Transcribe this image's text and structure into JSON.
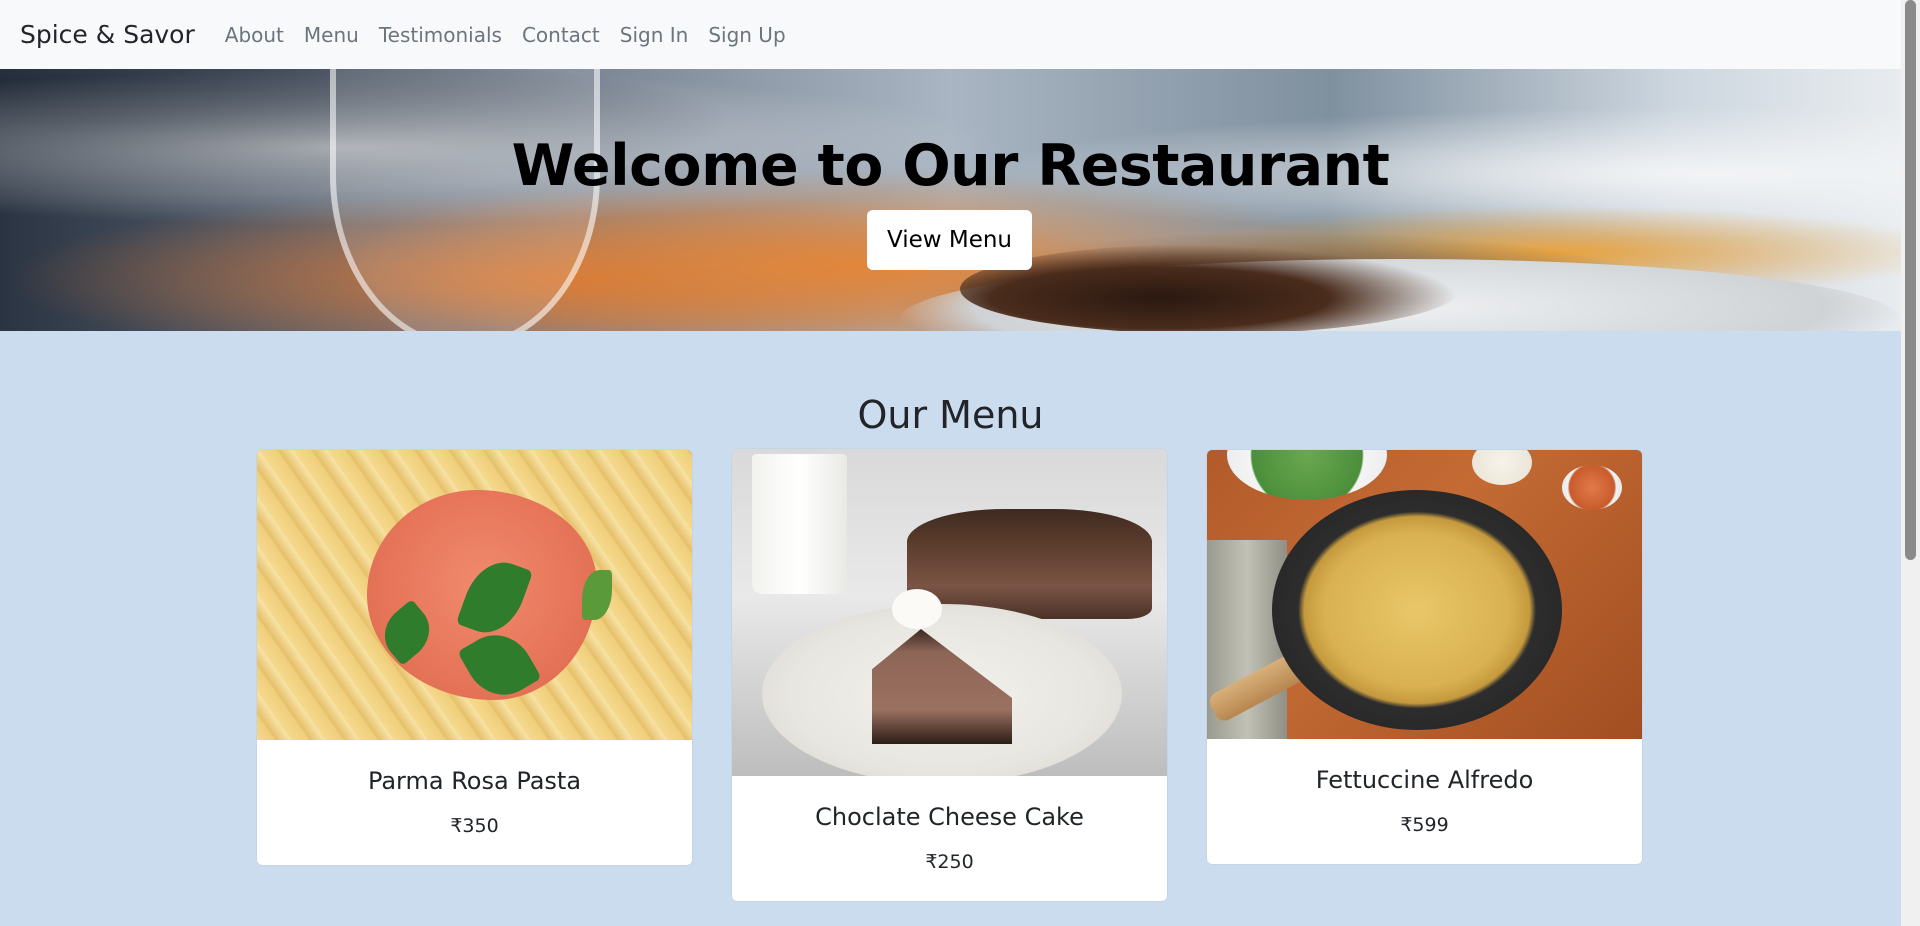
{
  "navbar": {
    "brand": "Spice & Savor",
    "links": [
      "About",
      "Menu",
      "Testimonials",
      "Contact",
      "Sign In",
      "Sign Up"
    ]
  },
  "hero": {
    "title": "Welcome to Our Restaurant",
    "button_label": "View Menu"
  },
  "menu": {
    "section_title": "Our Menu",
    "items": [
      {
        "name": "Parma Rosa Pasta",
        "price": "₹350",
        "image": "parma-rosa-pasta-image"
      },
      {
        "name": "Choclate Cheese Cake",
        "price": "₹250",
        "image": "chocolate-cheese-cake-image"
      },
      {
        "name": "Fettuccine Alfredo",
        "price": "₹599",
        "image": "fettuccine-alfredo-image"
      }
    ]
  },
  "colors": {
    "navbar_bg": "#f8f9fa",
    "page_bg": "#cbdcef",
    "nav_link": "#6c757d",
    "card_bg": "#ffffff"
  }
}
